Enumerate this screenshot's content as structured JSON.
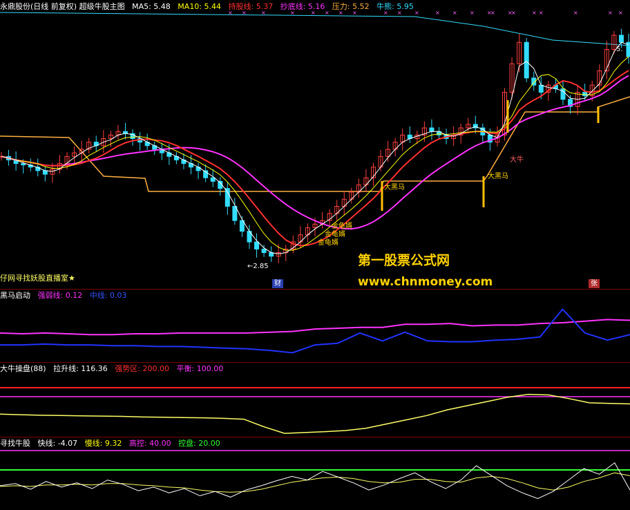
{
  "main_header": {
    "title": "永鼎股份(日线 前复权) 超级牛股主图",
    "items": [
      {
        "label": "MA5: 5.48",
        "color": "#ffffff"
      },
      {
        "label": "MA10: 5.44",
        "color": "#ffff00"
      },
      {
        "label": "持股线: 5.37",
        "color": "#ff3030"
      },
      {
        "label": "抄底线: 5.16",
        "color": "#ff33ff"
      },
      {
        "label": "压力: 5.52",
        "color": "#ffb040"
      },
      {
        "label": "牛熊: 5.95",
        "color": "#33ddff"
      }
    ]
  },
  "annotations": {
    "low_price": "←2.85",
    "high_price": "5.",
    "live_room": "仔网寻找妖股直播室★",
    "da_niu": "大牛",
    "heima1": "大黑马",
    "heima2": "大黑马",
    "jin1": "金龟婿",
    "jin2": "金龟婿",
    "jin3": "金龟婿",
    "cai": "财",
    "zhang": "张"
  },
  "watermark": {
    "line1": "第一股票公式网",
    "line2": "www.chnmoney.com"
  },
  "panel2_header": {
    "title": "黑马启动",
    "items": [
      {
        "label": "强弱线: 0.12",
        "color": "#ff33ff"
      },
      {
        "label": "中线: 0.03",
        "color": "#3355ff"
      }
    ]
  },
  "panel3_header": {
    "title": "大牛操盘(88)",
    "items": [
      {
        "label": "拉升线: 116.36",
        "color": "#ffffff"
      },
      {
        "label": "强势区: 200.00",
        "color": "#ff3030"
      },
      {
        "label": "平衡: 100.00",
        "color": "#ff33ff"
      }
    ]
  },
  "panel4_header": {
    "title": "寻找牛股",
    "items": [
      {
        "label": "快线: -4.07",
        "color": "#ffffff"
      },
      {
        "label": "慢线: 9.32",
        "color": "#ffff00"
      },
      {
        "label": "高控: 40.00",
        "color": "#ff33ff"
      },
      {
        "label": "控盘: 20.00",
        "color": "#33ff33"
      }
    ]
  },
  "chart_data": [
    {
      "type": "candlestick",
      "name": "main",
      "ylim": [
        2.5,
        6.3
      ],
      "low_marker": 2.85,
      "closes": [
        4.3,
        4.25,
        4.2,
        4.18,
        4.15,
        4.1,
        4.05,
        4.12,
        4.2,
        4.3,
        4.35,
        4.4,
        4.5,
        4.45,
        4.55,
        4.6,
        4.65,
        4.62,
        4.55,
        4.5,
        4.45,
        4.4,
        4.35,
        4.3,
        4.25,
        4.2,
        4.15,
        4.1,
        4.0,
        3.95,
        3.85,
        3.6,
        3.4,
        3.25,
        3.1,
        3.0,
        2.95,
        2.9,
        2.95,
        3.0,
        3.1,
        3.2,
        3.3,
        3.35,
        3.4,
        3.5,
        3.6,
        3.7,
        3.8,
        3.9,
        4.0,
        4.15,
        4.3,
        4.4,
        4.5,
        4.6,
        4.55,
        4.6,
        4.7,
        4.65,
        4.6,
        4.55,
        4.6,
        4.7,
        4.75,
        4.7,
        4.6,
        4.5,
        4.6,
        5.2,
        5.6,
        5.9,
        5.4,
        5.3,
        5.2,
        5.3,
        5.25,
        5.1,
        5.0,
        5.2,
        5.15,
        5.3,
        5.5,
        5.8,
        6.0,
        5.9,
        5.7
      ]
    },
    {
      "type": "line",
      "name": "黑马启动",
      "ylim": [
        -0.3,
        0.45
      ],
      "series": [
        {
          "name": "强弱线",
          "values": [
            0.05,
            0.04,
            0.05,
            0.04,
            0.03,
            0.03,
            0.04,
            0.04,
            0.05,
            0.05,
            0.05,
            0.05,
            0.06,
            0.07,
            0.1,
            0.11,
            0.12,
            0.12,
            0.16,
            0.16,
            0.17,
            0.14,
            0.15,
            0.15,
            0.17,
            0.18,
            0.2,
            0.22,
            0.21
          ]
        },
        {
          "name": "中线",
          "values": [
            -0.1,
            -0.1,
            -0.09,
            -0.1,
            -0.1,
            -0.11,
            -0.11,
            -0.12,
            -0.12,
            -0.13,
            -0.14,
            -0.15,
            -0.17,
            -0.2,
            -0.1,
            -0.08,
            0.05,
            -0.05,
            0.06,
            -0.05,
            -0.06,
            -0.06,
            -0.04,
            -0.03,
            0.0,
            0.35,
            0.05,
            -0.04,
            0.03
          ]
        }
      ]
    },
    {
      "type": "line",
      "name": "大牛操盘",
      "ylim": [
        0,
        220
      ],
      "series": [
        {
          "name": "拉升线",
          "values": [
            80,
            78,
            76,
            75,
            74,
            73,
            72,
            70,
            69,
            68,
            67,
            65,
            62,
            35,
            12,
            15,
            18,
            22,
            30,
            45,
            60,
            75,
            95,
            110,
            125,
            140,
            150,
            148,
            135,
            120,
            118,
            116
          ]
        }
      ]
    },
    {
      "type": "line",
      "name": "寻找牛股",
      "ylim": [
        -30,
        55
      ],
      "series": [
        {
          "name": "快线",
          "values": [
            2,
            5,
            -3,
            8,
            0,
            6,
            -2,
            10,
            4,
            -5,
            0,
            -8,
            -2,
            -12,
            -6,
            -14,
            -4,
            2,
            9,
            15,
            10,
            22,
            14,
            6,
            -4,
            3,
            12,
            20,
            8,
            -2,
            10,
            30,
            16,
            2,
            -8,
            -16,
            -6,
            10,
            26,
            18,
            34,
            -4
          ]
        },
        {
          "name": "慢线",
          "values": [
            1,
            2,
            1,
            3,
            3,
            4,
            3,
            5,
            5,
            3,
            2,
            0,
            -1,
            -4,
            -6,
            -7,
            -6,
            -3,
            2,
            7,
            10,
            13,
            14,
            12,
            8,
            6,
            7,
            11,
            11,
            8,
            7,
            13,
            15,
            12,
            6,
            -1,
            -4,
            0,
            8,
            13,
            20,
            16
          ]
        }
      ]
    }
  ]
}
